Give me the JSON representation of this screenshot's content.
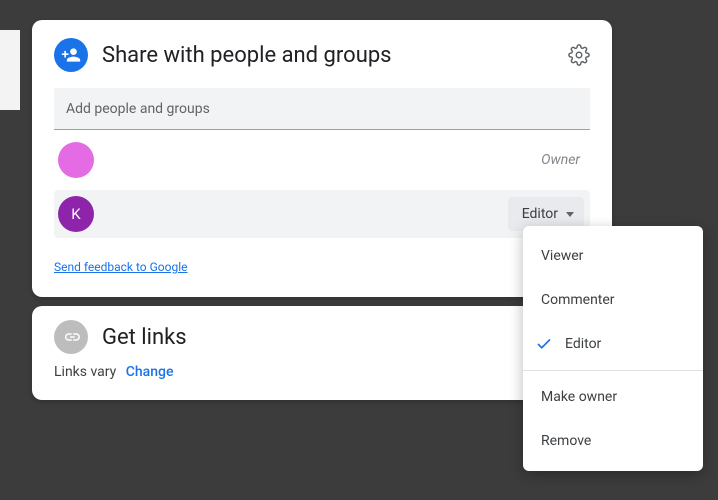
{
  "share": {
    "title": "Share with people and groups",
    "input_placeholder": "Add people and groups",
    "feedback": "Send feedback to Google",
    "people": [
      {
        "initial": "",
        "color": "#e56be5",
        "role_label": "Owner",
        "role_kind": "owner"
      },
      {
        "initial": "K",
        "color": "#8e24aa",
        "role_label": "Editor",
        "role_kind": "dropdown"
      }
    ]
  },
  "links": {
    "title": "Get links",
    "status": "Links vary",
    "change": "Change"
  },
  "role_menu": {
    "items": [
      {
        "label": "Viewer",
        "checked": false
      },
      {
        "label": "Commenter",
        "checked": false
      },
      {
        "label": "Editor",
        "checked": true
      }
    ],
    "extra": [
      {
        "label": "Make owner"
      },
      {
        "label": "Remove"
      }
    ]
  }
}
